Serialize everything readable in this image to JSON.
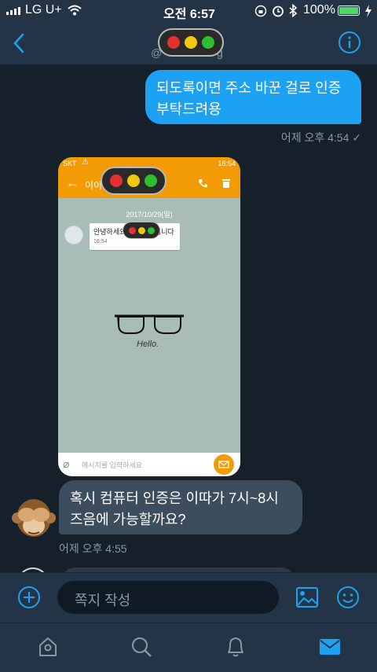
{
  "status": {
    "carrier": "LG U+",
    "time": "오전 6:57",
    "battery": "100%"
  },
  "messages": [
    {
      "text": "되도록이면 주소 바꾼 걸로 인증 부탁드려용",
      "line1": "되도록이면 주소 바꾼 걸로 인증",
      "line2": "부탁드려용",
      "meta": "어제 오후 4:54 ✓"
    },
    {
      "text": "혹시 컴퓨터 인증은 이따가 7시~8시 즈음에 가능할까요?",
      "line1": "혹시 컴퓨터 인증은 이따가 7시~8시",
      "line2": "즈음에 가능할까요?",
      "meta": "어제 오후 4:55"
    }
  ],
  "screenshot": {
    "status_left": "SKT",
    "status_right": "16:54",
    "header_title": "이이",
    "date_label": "2017/10/29(일)",
    "msg_prefix": "안녕하세요",
    "msg_suffix": "입니다",
    "msg_time": "16:54",
    "caption": "Hello.",
    "input_placeholder": "메시지를 입력하세요"
  },
  "composer": {
    "placeholder": "쪽지 작성"
  },
  "colors": {
    "accent": "#1da1f2",
    "header_bg": "#243447",
    "chat_bg": "#15202b",
    "shot_header": "#f29b05"
  }
}
